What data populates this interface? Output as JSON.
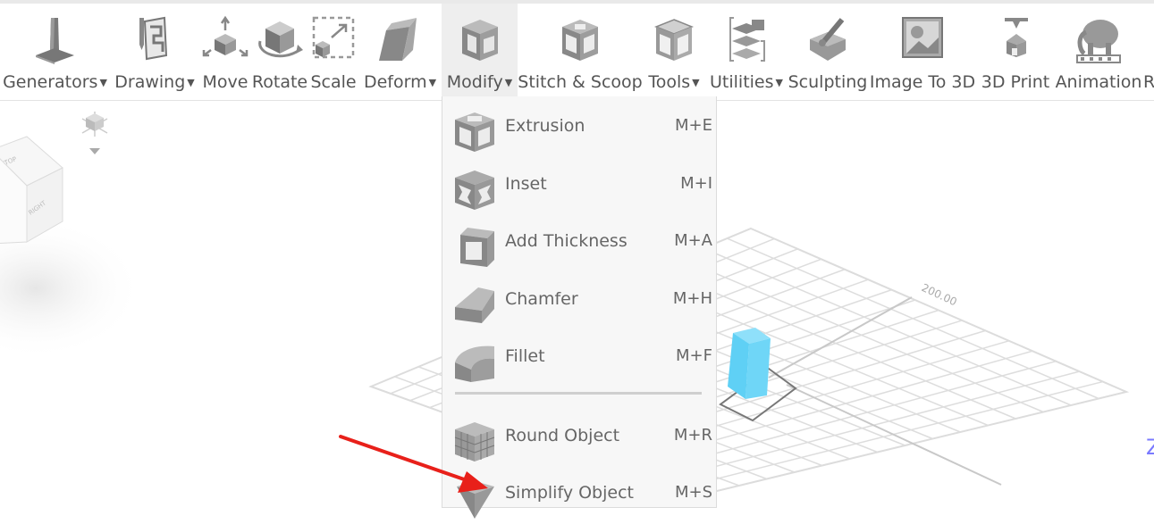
{
  "toolbar": {
    "items": [
      {
        "label": "Generators",
        "dropdown": true,
        "icon": "generators-icon"
      },
      {
        "label": "Drawing",
        "dropdown": true,
        "icon": "drawing-icon"
      },
      {
        "label": "Move",
        "dropdown": false,
        "icon": "move-icon"
      },
      {
        "label": "Rotate",
        "dropdown": false,
        "icon": "rotate-icon"
      },
      {
        "label": "Scale",
        "dropdown": false,
        "icon": "scale-icon"
      },
      {
        "label": "Deform",
        "dropdown": true,
        "icon": "deform-icon"
      },
      {
        "label": "Modify",
        "dropdown": true,
        "icon": "modify-icon",
        "active": true
      },
      {
        "label": "Stitch & Scoop",
        "dropdown": false,
        "icon": "stitch-scoop-icon"
      },
      {
        "label": "Tools",
        "dropdown": true,
        "icon": "tools-icon"
      },
      {
        "label": "Utilities",
        "dropdown": true,
        "icon": "utilities-icon"
      },
      {
        "label": "Sculpting",
        "dropdown": false,
        "icon": "sculpting-icon"
      },
      {
        "label": "Image To 3D",
        "dropdown": false,
        "icon": "image-to-3d-icon"
      },
      {
        "label": "3D Print",
        "dropdown": false,
        "icon": "3d-print-icon"
      },
      {
        "label": "Animation",
        "dropdown": false,
        "icon": "animation-icon"
      },
      {
        "label": "R",
        "dropdown": false,
        "icon": ""
      }
    ]
  },
  "modify_menu": {
    "items": [
      {
        "label": "Extrusion",
        "shortcut": "M+E",
        "icon": "extrusion-icon"
      },
      {
        "label": "Inset",
        "shortcut": "M+I",
        "icon": "inset-icon"
      },
      {
        "label": "Add Thickness",
        "shortcut": "M+A",
        "icon": "add-thickness-icon"
      },
      {
        "label": "Chamfer",
        "shortcut": "M+H",
        "icon": "chamfer-icon"
      },
      {
        "label": "Fillet",
        "shortcut": "M+F",
        "icon": "fillet-icon"
      },
      {
        "label": "Round Object",
        "shortcut": "M+R",
        "icon": "round-object-icon"
      },
      {
        "label": "Simplify Object",
        "shortcut": "M+S",
        "icon": "simplify-object-icon"
      }
    ]
  },
  "viewport": {
    "view_cube": {
      "top_label": "TOP",
      "right_label": "RIGHT"
    },
    "grid_label": "200.00",
    "partial_text": "Z",
    "object_color": "#5fd0f5",
    "annotation_color": "#e8201a"
  }
}
